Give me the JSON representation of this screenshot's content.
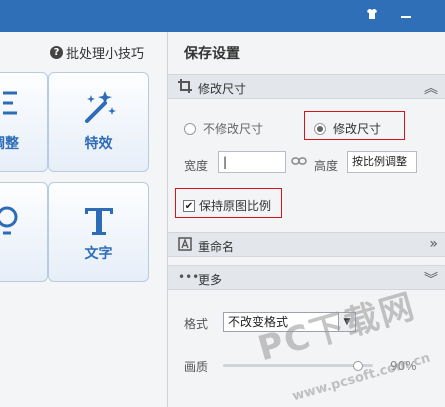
{
  "titlebar": {
    "icons": [
      "shirt-icon",
      "minimize-icon"
    ]
  },
  "left": {
    "tips": {
      "icon": "question-icon",
      "label": "批处理小技巧"
    },
    "tiles": [
      {
        "label": "调整",
        "icon": "adjust-icon"
      },
      {
        "label": "特效",
        "icon": "magic-wand-icon"
      },
      {
        "label": "",
        "icon": "partial-icon"
      },
      {
        "label": "文字",
        "icon": "text-T-icon"
      }
    ]
  },
  "panel": {
    "title": "保存设置",
    "resize_section": {
      "label": "修改尺寸",
      "chevron": "︽",
      "radio_keep": "不修改尺寸",
      "radio_modify": "修改尺寸",
      "width_label": "宽度",
      "width_value": "|",
      "height_label": "高度",
      "height_value": "按比例调整",
      "keep_ratio": "保持原图比例"
    },
    "rename_section": {
      "label": "重命名",
      "chevron": "»"
    },
    "more_section": {
      "label": "更多",
      "chevron": "︾",
      "format_label": "格式",
      "format_value": "不改变格式",
      "quality_label": "画质",
      "quality_value": "90%",
      "quality_percent": 90
    }
  },
  "watermark": {
    "line1": "PC下载网",
    "line2": "www.pcsoft.com.cn"
  },
  "colors": {
    "accent": "#2d6cb6",
    "titlebar": "#2e6fb8",
    "highlight_border": "#d6141f"
  }
}
